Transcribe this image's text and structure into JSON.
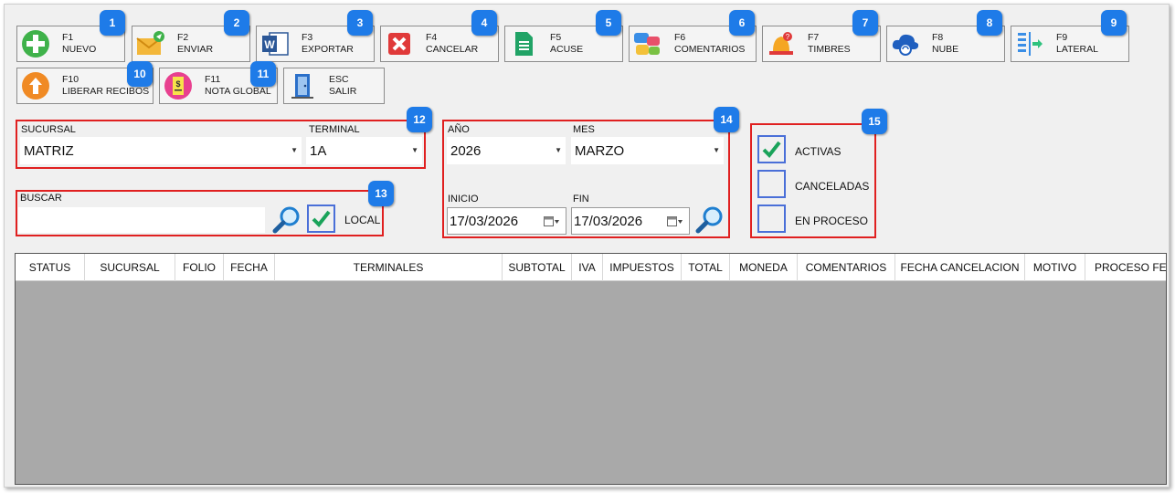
{
  "toolbar": [
    {
      "key": "F1",
      "label": "NUEVO",
      "icon": "plus-circle-icon",
      "badge": "1"
    },
    {
      "key": "F2",
      "label": "ENVIAR",
      "icon": "send-mail-icon",
      "badge": "2"
    },
    {
      "key": "F3",
      "label": "EXPORTAR",
      "icon": "word-document-icon",
      "badge": "3"
    },
    {
      "key": "F4",
      "label": "CANCELAR",
      "icon": "cancel-x-icon",
      "badge": "4"
    },
    {
      "key": "F5",
      "label": "ACUSE",
      "icon": "sheet-document-icon",
      "badge": "5"
    },
    {
      "key": "F6",
      "label": "COMENTARIOS",
      "icon": "chat-bubbles-icon",
      "badge": "6"
    },
    {
      "key": "F7",
      "label": "TIMBRES",
      "icon": "bell-icon",
      "badge": "7"
    },
    {
      "key": "F8",
      "label": "NUBE",
      "icon": "cloud-sync-icon",
      "badge": "8"
    },
    {
      "key": "F9",
      "label": "LATERAL",
      "icon": "side-panel-icon",
      "badge": "9"
    },
    {
      "key": "F10",
      "label": "LIBERAR RECIBOS",
      "icon": "arrow-up-circle-icon",
      "badge": "10"
    },
    {
      "key": "F11",
      "label": "NOTA GLOBAL",
      "icon": "receipt-icon",
      "badge": "11"
    },
    {
      "key": "ESC",
      "label": "SALIR",
      "icon": "exit-door-icon",
      "badge": ""
    }
  ],
  "filters": {
    "sucursal_label": "SUCURSAL",
    "sucursal_value": "MATRIZ",
    "terminal_label": "TERMINAL",
    "terminal_value": "1A",
    "group_badge_1": "12",
    "buscar_label": "BUSCAR",
    "buscar_value": "",
    "local_label": "LOCAL",
    "local_checked": true,
    "group_badge_2": "13",
    "anio_label": "AÑO",
    "anio_value": "2026",
    "mes_label": "MES",
    "mes_value": "MARZO",
    "inicio_label": "INICIO",
    "inicio_value": "17/03/2026",
    "fin_label": "FIN",
    "fin_value": "17/03/2026",
    "group_badge_3": "14",
    "status_badge": "15",
    "status_options": [
      {
        "label": "ACTIVAS",
        "checked": true
      },
      {
        "label": "CANCELADAS",
        "checked": false
      },
      {
        "label": "EN PROCESO",
        "checked": false
      }
    ]
  },
  "grid": {
    "columns": [
      "STATUS",
      "SUCURSAL",
      "FOLIO",
      "FECHA",
      "TERMINALES",
      "SUBTOTAL",
      "IVA",
      "IMPUESTOS",
      "TOTAL",
      "MONEDA",
      "COMENTARIOS",
      "FECHA CANCELACION",
      "MOTIVO",
      "PROCESO FE"
    ],
    "rows": []
  },
  "colors": {
    "badge": "#1e7be8",
    "highlight": "#e02020",
    "grid_bg": "#a9a9a9",
    "check_green": "#1aa35a"
  }
}
